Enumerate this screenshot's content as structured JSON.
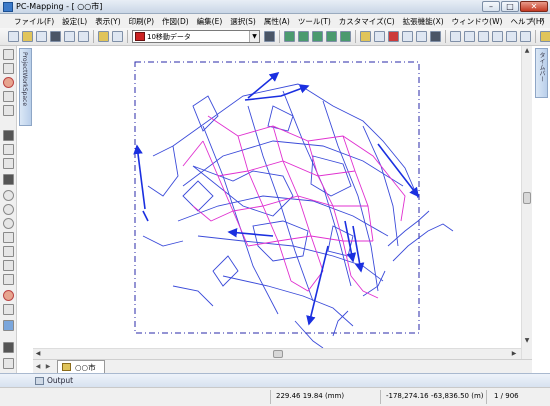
{
  "window": {
    "title": "PC-Mapping - [ ○○市]",
    "minimize": "–",
    "maximize": "□",
    "close": "✕"
  },
  "menu": {
    "items": [
      "ファイル(F)",
      "設定(L)",
      "表示(Y)",
      "印刷(P)",
      "作図(D)",
      "編集(E)",
      "選択(S)",
      "属性(A)",
      "ツール(T)",
      "カスタマイズ(C)",
      "拡張機能(X)",
      "ウィンドウ(W)",
      "ヘルプ(H)"
    ],
    "mdi_min": "–",
    "mdi_restore": "▫",
    "mdi_close": "x"
  },
  "toolbar": {
    "layer_value": "10移動データ",
    "dropdown_arrow": "▼"
  },
  "side_tabs": {
    "left": "ProjectWorkSpace",
    "right": "タイムバー"
  },
  "map": {
    "colors": {
      "road_blue": "#3b4bd9",
      "arrow_blue": "#1a2fe0",
      "route_magenta": "#e030d0",
      "frame": "#2a2aaa"
    }
  },
  "scroll": {
    "up": "▲",
    "down": "▼",
    "left": "◀",
    "right": "▶"
  },
  "tabs": {
    "nav_prev": "◀",
    "nav_next": "▶",
    "document": "○○市"
  },
  "output": {
    "label": "Output"
  },
  "status": {
    "paper_coords": "229.46 19.84 (mm)",
    "map_coords": "-178,274.16 -63,836.50 (m)",
    "page": "1 / 906"
  }
}
